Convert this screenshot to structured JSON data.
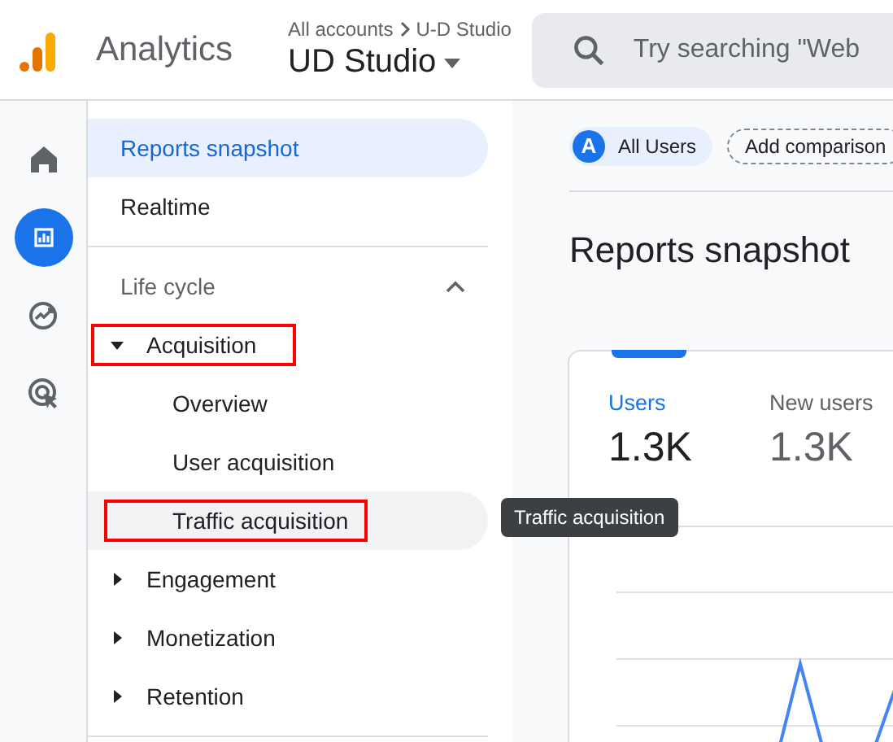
{
  "header": {
    "product": "Analytics",
    "breadcrumb": "All accounts",
    "breadcrumb_current": "U-D Studio",
    "property": "UD Studio",
    "search": {
      "placeholder": "Try searching \"Web"
    }
  },
  "rail": [
    {
      "kind": "home",
      "selected": false
    },
    {
      "kind": "reports",
      "selected": true
    },
    {
      "kind": "explore",
      "selected": false
    },
    {
      "kind": "advertising",
      "selected": false
    }
  ],
  "nav": [
    {
      "kind": "item",
      "label": "Reports snapshot",
      "selected": true
    },
    {
      "kind": "item",
      "label": "Realtime",
      "selected": false
    },
    {
      "kind": "section",
      "label": "Life cycle",
      "expanded": true,
      "children": [
        {
          "label": "Acquisition",
          "expanded": true,
          "highlighted": true,
          "children": [
            {
              "label": "Overview",
              "selected": false,
              "hovered": false,
              "highlighted": false
            },
            {
              "label": "User acquisition",
              "selected": false,
              "hovered": false,
              "highlighted": false
            },
            {
              "label": "Traffic acquisition",
              "selected": false,
              "hovered": true,
              "highlighted": true
            }
          ]
        },
        {
          "label": "Engagement",
          "expanded": false,
          "highlighted": false
        },
        {
          "label": "Monetization",
          "expanded": false,
          "highlighted": false
        },
        {
          "label": "Retention",
          "expanded": false,
          "highlighted": false
        }
      ]
    }
  ],
  "tooltip": "Traffic acquisition",
  "segment": {
    "avatar": "A",
    "label": "All Users"
  },
  "add_comparison": "Add comparison",
  "title": "Reports snapshot",
  "metrics": [
    {
      "label": "Users",
      "value": "1.3K",
      "selected": true
    },
    {
      "label": "New users",
      "value": "1.3K",
      "selected": false
    }
  ]
}
